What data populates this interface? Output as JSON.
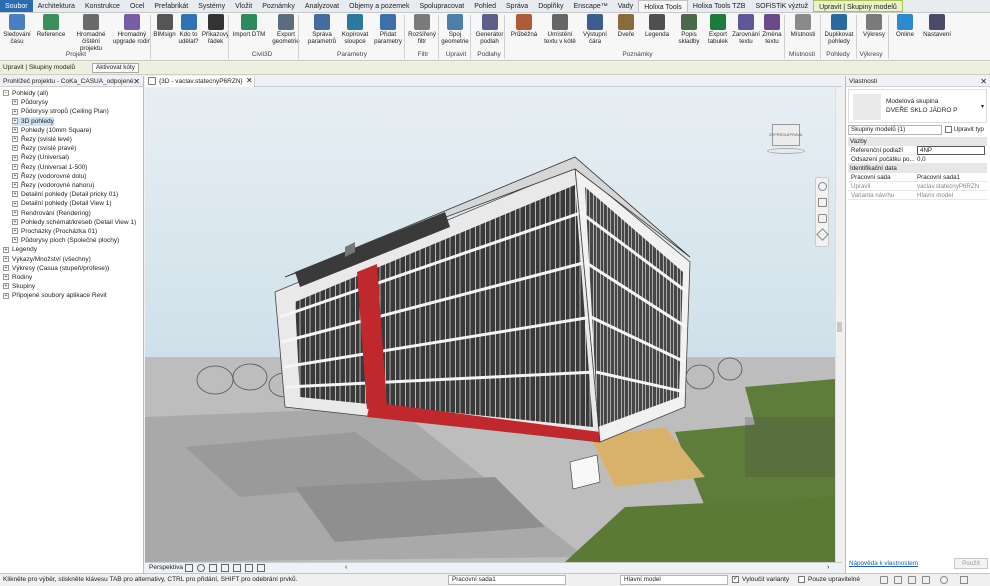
{
  "tabs": [
    "Soubor",
    "Architektura",
    "Konstrukce",
    "Ocel",
    "Prefabrikát",
    "Systémy",
    "Vložit",
    "Poznámky",
    "Analyzovat",
    "Objemy a pozemek",
    "Spolupracovat",
    "Pohled",
    "Správa",
    "Doplňky",
    "Enscape™",
    "Vady",
    "Holixa Tools",
    "Holixa Tools TZB",
    "SOFiSTiK výztuž",
    "Upravit | Skupiny modelů"
  ],
  "ribbon": {
    "buttons": [
      "Sledování času",
      "Reference",
      "Hromadné čištění projektu",
      "Hromadný upgrade rodin",
      "BIMsign",
      "Kdo to udělal?",
      "Příkazový řádek",
      "Import DTM",
      "Export geometrie",
      "Správa parametrů",
      "Kopírovat sloupce",
      "Přidat parametry",
      "Rozšířený filtr",
      "Spoj geometrie",
      "Generátor podlah",
      "Průběžná",
      "Umístění textu v kótě",
      "Výstupní čára",
      "Dveře",
      "Legenda",
      "Popis skladby",
      "Export tabulek",
      "Zarovnání textu",
      "Změna textu",
      "Místnosti",
      "Duplikovat pohledy",
      "Výkresy",
      "Online",
      "Nastavení"
    ],
    "groups": [
      "Projekt",
      "Civil3D",
      "Parametry",
      "Filtr",
      "Upravit",
      "Podlahy",
      "Poznámky",
      "Místnosti",
      "Pohledy",
      "Výkresy"
    ]
  },
  "context_bar": {
    "label": "Upravit | Skupiny modelů",
    "button": "Aktivovat kóty"
  },
  "browser": {
    "title": "Prohlížeč projektu - CoKa_CASUA_odpojené",
    "items": [
      {
        "label": "Pohledy (all)",
        "level": 0,
        "exp": "−"
      },
      {
        "label": "Půdorysy",
        "level": 1,
        "exp": "+"
      },
      {
        "label": "Půdorysy stropů (Ceiling Plan)",
        "level": 1,
        "exp": "+"
      },
      {
        "label": "3D pohledy",
        "level": 1,
        "exp": "+"
      },
      {
        "label": "Pohledy (10mm Square)",
        "level": 1,
        "exp": "+"
      },
      {
        "label": "Řezy (svislé levé)",
        "level": 1,
        "exp": "+"
      },
      {
        "label": "Řezy (svislé pravé)",
        "level": 1,
        "exp": "+"
      },
      {
        "label": "Řezy (Universal)",
        "level": 1,
        "exp": "+"
      },
      {
        "label": "Řezy (Universal 1-500)",
        "level": 1,
        "exp": "+"
      },
      {
        "label": "Řezy (vodorovné dolu)",
        "level": 1,
        "exp": "+"
      },
      {
        "label": "Řezy (vodorovné nahoru)",
        "level": 1,
        "exp": "+"
      },
      {
        "label": "Detailní pohledy (Detail pricky 01)",
        "level": 1,
        "exp": "+"
      },
      {
        "label": "Detailní pohledy (Detail View 1)",
        "level": 1,
        "exp": "+"
      },
      {
        "label": "Rendrování (Rendering)",
        "level": 1,
        "exp": "+"
      },
      {
        "label": "Pohledy schémat/kreseb (Detail View 1)",
        "level": 1,
        "exp": "+"
      },
      {
        "label": "Procházky (Procházka 01)",
        "level": 1,
        "exp": "+"
      },
      {
        "label": "Půdorysy ploch (Společné plochy)",
        "level": 1,
        "exp": "+"
      },
      {
        "label": "Legendy",
        "level": 0,
        "exp": "+"
      },
      {
        "label": "Výkazy/Množství (všechny)",
        "level": 0,
        "exp": "+"
      },
      {
        "label": "Výkresy (Casua (stupeň/profese))",
        "level": 0,
        "exp": "+"
      },
      {
        "label": "Rodiny",
        "level": 0,
        "exp": "+"
      },
      {
        "label": "Skupiny",
        "level": 0,
        "exp": "+"
      },
      {
        "label": "Připojené soubory aplikace Revit",
        "level": 0,
        "exp": "+"
      }
    ]
  },
  "view": {
    "tab_title": "{3D - vaclav.statecnyP6RZN}",
    "mode": "Perspektiva",
    "viewcube_left": "ZEPŘEDU",
    "viewcube_right": "ZPRAVA"
  },
  "properties": {
    "title": "Vlastnosti",
    "type_line1": "Modelová skupina",
    "type_line2": "DVEŘE SKLO JÁDRO P",
    "selector": "Skupiny modelů (1)",
    "edit_type": "Upravit typ",
    "sections": [
      {
        "name": "Vazby",
        "rows": [
          [
            "Referenční podlaží",
            "4NP"
          ],
          [
            "Odsazení počátku po...",
            "0,0"
          ]
        ]
      },
      {
        "name": "Identifikační data",
        "rows": [
          [
            "Pracovní sada",
            "Pracovní sada1"
          ],
          [
            "Upravil",
            "vaclav.statecnyP6RZN"
          ],
          [
            "Varianta návrhu",
            "Hlavní model"
          ]
        ]
      }
    ],
    "help_link": "Nápověda k vlastnostem",
    "apply": "Použít"
  },
  "status": {
    "hint": "Klikněte pro výběr, stiskněte klávesu TAB pro alternativy, CTRL pro přidání, SHIFT pro odebrání prvků.",
    "workset": "Pracovní sada1",
    "design_option": "Hlavní model",
    "exclude_variants": "Vyloučit varianty",
    "editable_only": "Pouze upravitelné"
  },
  "colors": {
    "accent": "#2b6cb0",
    "facade_red": "#c0282d",
    "grass": "#5e7d3a",
    "sky_top": "#cfe0ea"
  }
}
